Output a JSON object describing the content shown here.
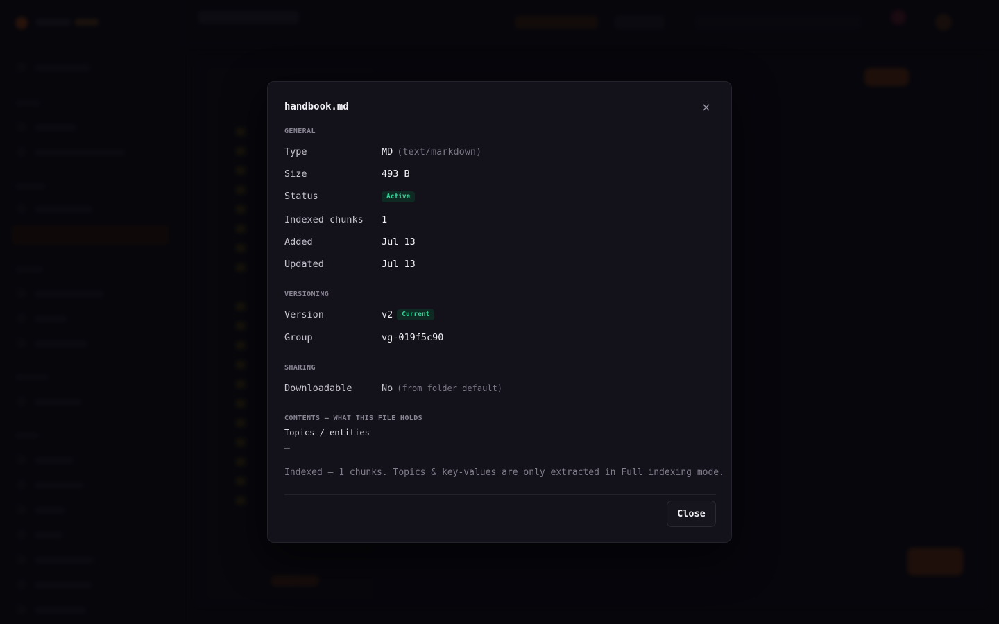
{
  "modal": {
    "title": "handbook.md",
    "general": {
      "heading": "GENERAL",
      "type_label": "Type",
      "type_value": "MD",
      "type_mime": "(text/markdown)",
      "size_label": "Size",
      "size_value": "493 B",
      "status_label": "Status",
      "status_value": "Active",
      "chunks_label": "Indexed chunks",
      "chunks_value": "1",
      "added_label": "Added",
      "added_value": "Jul 13",
      "updated_label": "Updated",
      "updated_value": "Jul 13"
    },
    "versioning": {
      "heading": "VERSIONING",
      "version_label": "Version",
      "version_value": "v2",
      "version_badge": "Current",
      "group_label": "Group",
      "group_value": "vg-019f5c90"
    },
    "sharing": {
      "heading": "SHARING",
      "downloadable_label": "Downloadable",
      "downloadable_value": "No",
      "downloadable_note": "(from folder default)"
    },
    "contents": {
      "heading": "CONTENTS — WHAT THIS FILE HOLDS",
      "topics_label": "Topics / entities",
      "topics_empty": "—",
      "note": "Indexed — 1 chunks. Topics & key-values are only extracted in Full indexing mode."
    },
    "close_label": "Close",
    "close_icon": "×"
  },
  "colors": {
    "accent": "#e8732a",
    "status_green": "#34d399",
    "modal_bg": "#13111a"
  },
  "icons": {
    "close": "close-icon"
  }
}
